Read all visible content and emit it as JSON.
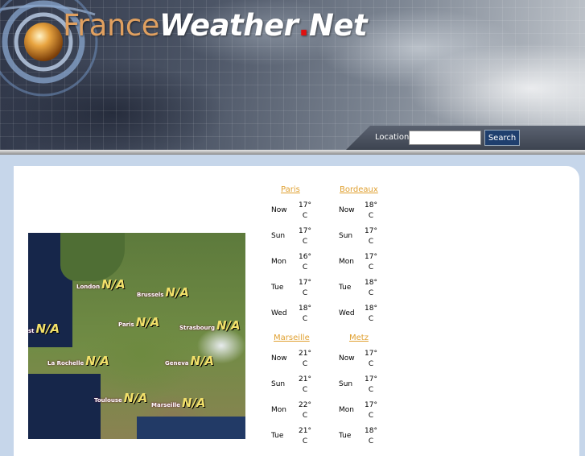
{
  "site": {
    "logo_light": "France",
    "logo_bold": "Weather",
    "logo_dot": ".",
    "logo_tld": "Net"
  },
  "search": {
    "label": "Location",
    "placeholder": "",
    "button": "Search"
  },
  "map": {
    "cities": [
      {
        "name": "London",
        "value": "N/A"
      },
      {
        "name": "Brussels",
        "value": "N/A"
      },
      {
        "name": "st",
        "value": "N/A"
      },
      {
        "name": "Paris",
        "value": "N/A"
      },
      {
        "name": "Strasbourg",
        "value": "N/A"
      },
      {
        "name": "La Rochelle",
        "value": "N/A"
      },
      {
        "name": "Geneva",
        "value": "N/A"
      },
      {
        "name": "Toulouse",
        "value": "N/A"
      },
      {
        "name": "Marseille",
        "value": "N/A"
      }
    ]
  },
  "forecasts": [
    {
      "city": "Paris",
      "days": [
        {
          "day": "Now",
          "temp": "17°",
          "unit": "C"
        },
        {
          "day": "Sun",
          "temp": "17°",
          "unit": "C"
        },
        {
          "day": "Mon",
          "temp": "16°",
          "unit": "C"
        },
        {
          "day": "Tue",
          "temp": "17°",
          "unit": "C"
        },
        {
          "day": "Wed",
          "temp": "18°",
          "unit": "C"
        }
      ]
    },
    {
      "city": "Bordeaux",
      "days": [
        {
          "day": "Now",
          "temp": "18°",
          "unit": "C"
        },
        {
          "day": "Sun",
          "temp": "17°",
          "unit": "C"
        },
        {
          "day": "Mon",
          "temp": "17°",
          "unit": "C"
        },
        {
          "day": "Tue",
          "temp": "18°",
          "unit": "C"
        },
        {
          "day": "Wed",
          "temp": "18°",
          "unit": "C"
        }
      ]
    },
    {
      "city": "Marseille",
      "days": [
        {
          "day": "Now",
          "temp": "21°",
          "unit": "C"
        },
        {
          "day": "Sun",
          "temp": "21°",
          "unit": "C"
        },
        {
          "day": "Mon",
          "temp": "22°",
          "unit": "C"
        },
        {
          "day": "Tue",
          "temp": "21°",
          "unit": "C"
        }
      ]
    },
    {
      "city": "Metz",
      "days": [
        {
          "day": "Now",
          "temp": "17°",
          "unit": "C"
        },
        {
          "day": "Sun",
          "temp": "17°",
          "unit": "C"
        },
        {
          "day": "Mon",
          "temp": "17°",
          "unit": "C"
        },
        {
          "day": "Tue",
          "temp": "18°",
          "unit": "C"
        }
      ]
    }
  ]
}
